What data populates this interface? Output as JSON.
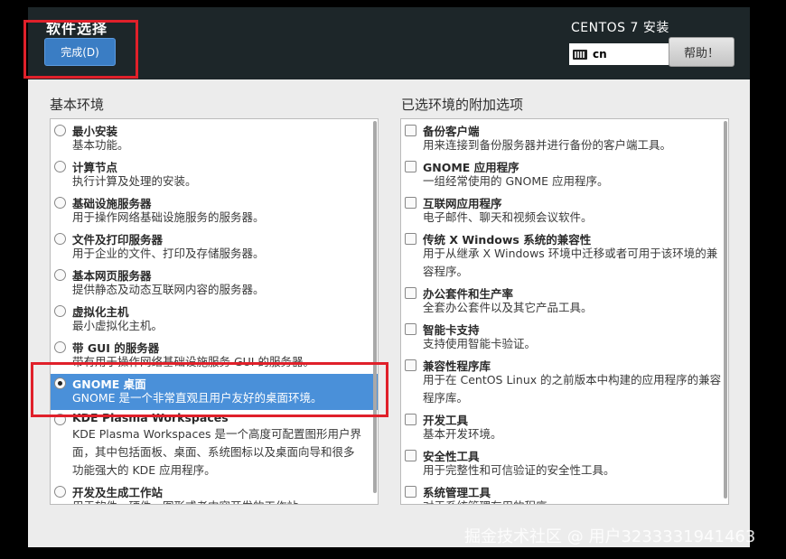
{
  "header": {
    "spoke_title": "软件选择",
    "done_button": "完成(D)",
    "product_title": "CENTOS 7 安装",
    "keyboard_layout": "cn",
    "help_button": "帮助！"
  },
  "base_env": {
    "label": "基本环境",
    "items": [
      {
        "name": "最小安装",
        "desc": "基本功能。",
        "selected": false
      },
      {
        "name": "计算节点",
        "desc": "执行计算及处理的安装。",
        "selected": false
      },
      {
        "name": "基础设施服务器",
        "desc": "用于操作网络基础设施服务的服务器。",
        "selected": false
      },
      {
        "name": "文件及打印服务器",
        "desc": "用于企业的文件、打印及存储服务器。",
        "selected": false
      },
      {
        "name": "基本网页服务器",
        "desc": "提供静态及动态互联网内容的服务器。",
        "selected": false
      },
      {
        "name": "虚拟化主机",
        "desc": "最小虚拟化主机。",
        "selected": false
      },
      {
        "name": "带 GUI 的服务器",
        "desc": "带有用于操作网络基础设施服务 GUI 的服务器。",
        "selected": false
      },
      {
        "name": "GNOME 桌面",
        "desc": "GNOME 是一个非常直观且用户友好的桌面环境。",
        "selected": true
      },
      {
        "name": "KDE Plasma Workspaces",
        "desc": "KDE Plasma Workspaces 是一个高度可配置图形用户界\n面，其中包括面板、桌面、系统图标以及桌面向导和很多\n功能强大的 KDE 应用程序。",
        "selected": false
      },
      {
        "name": "开发及生成工作站",
        "desc": "用于软件、硬件、图形或者内容开发的工作站。",
        "selected": false
      }
    ]
  },
  "addons": {
    "label": "已选环境的附加选项",
    "items": [
      {
        "name": "备份客户端",
        "desc": "用来连接到备份服务器并进行备份的客户端工具。",
        "checked": false
      },
      {
        "name": "GNOME 应用程序",
        "desc": "一组经常使用的 GNOME 应用程序。",
        "checked": false
      },
      {
        "name": "互联网应用程序",
        "desc": "电子邮件、聊天和视频会议软件。",
        "checked": false
      },
      {
        "name": "传统 X Windows 系统的兼容性",
        "desc": "用于从继承 X Windows 环境中迁移或者可用于该环境的兼\n容程序。",
        "checked": false
      },
      {
        "name": "办公套件和生产率",
        "desc": "全套办公套件以及其它产品工具。",
        "checked": false
      },
      {
        "name": "智能卡支持",
        "desc": "支持使用智能卡验证。",
        "checked": false
      },
      {
        "name": "兼容性程序库",
        "desc": "用于在 CentOS Linux 的之前版本中构建的应用程序的兼容\n程序库。",
        "checked": false
      },
      {
        "name": "开发工具",
        "desc": "基本开发环境。",
        "checked": false
      },
      {
        "name": "安全性工具",
        "desc": "用于完整性和可信验证的安全性工具。",
        "checked": false
      },
      {
        "name": "系统管理工具",
        "desc": "对于系统管理有用的程序。",
        "checked": false
      }
    ]
  },
  "watermark": "掘金技术社区 @ 用户3233331941463"
}
